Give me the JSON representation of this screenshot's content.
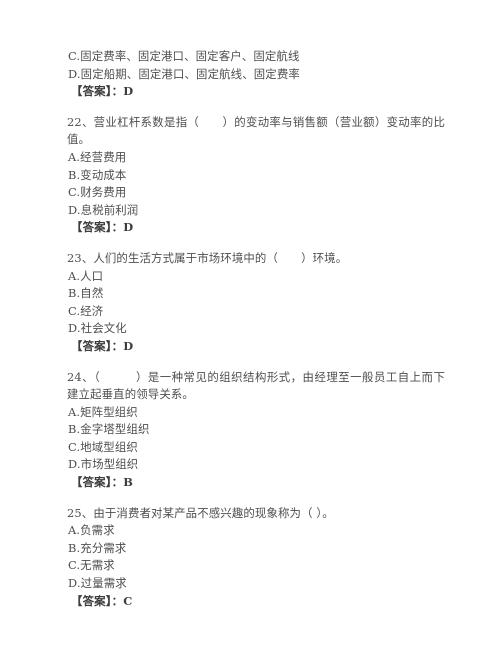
{
  "document": {
    "type": "exam-question-sheet",
    "language": "zh-CN",
    "text_color": "#4e4e4e",
    "background_color": "#ffffff",
    "answer_label": "【答案】"
  },
  "blocks": [
    {
      "id": "q21-tail",
      "lines": [
        "C.固定费率、固定港口、固定客户、固定航线",
        "D.固定船期、固定港口、固定航线、固定费率"
      ],
      "answer": "【答案】：D"
    },
    {
      "id": "q22",
      "number": "22",
      "stem": "22、营业杠杆系数是指（　　）的变动率与销售额（营业额）变动率的比值。",
      "options": [
        "A.经营费用",
        "B.变动成本",
        "C.财务费用",
        "D.息税前利润"
      ],
      "answer": "【答案】：D"
    },
    {
      "id": "q23",
      "number": "23",
      "stem": "23、人们的生活方式属于市场环境中的（　　）环境。",
      "options": [
        "A.人口",
        "B.自然",
        "C.经济",
        "D.社会文化"
      ],
      "answer": "【答案】：D"
    },
    {
      "id": "q24",
      "number": "24",
      "stem": "24、（　　　）是一种常见的组织结构形式，由经理至一般员工自上而下建立起垂直的领导关系。",
      "options": [
        "A.矩阵型组织",
        "B.金字塔型组织",
        "C.地域型组织",
        "D.市场型组织"
      ],
      "answer": "【答案】：B"
    },
    {
      "id": "q25",
      "number": "25",
      "stem": "25、由于消费者对某产品不感兴趣的现象称为（ ）。",
      "options": [
        "A.负需求",
        "B.充分需求",
        "C.无需求",
        "D.过量需求"
      ],
      "answer": "【答案】：C"
    }
  ]
}
